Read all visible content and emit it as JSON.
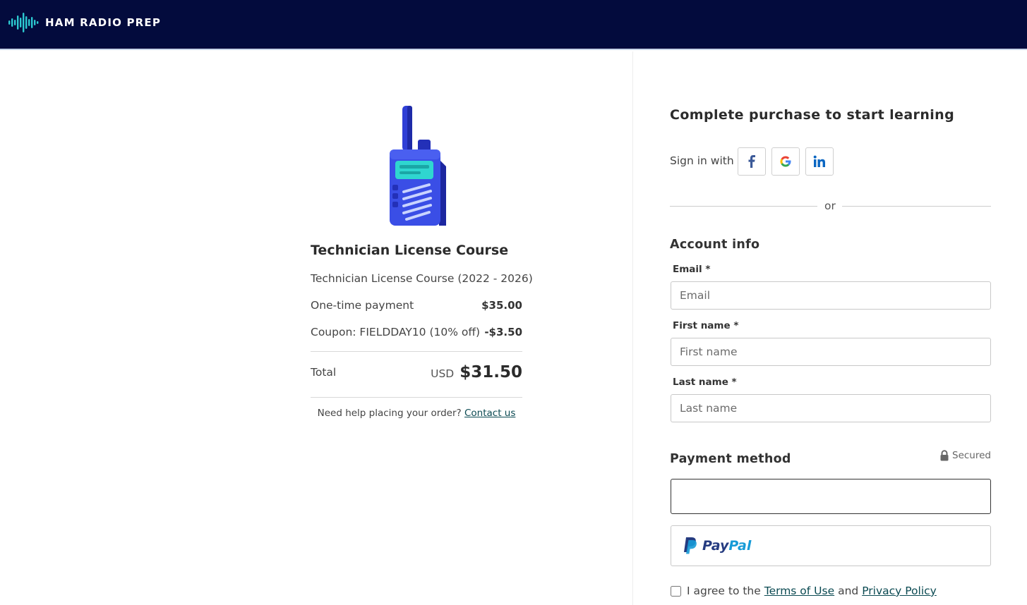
{
  "header": {
    "brand_name": "HAM RADIO PREP"
  },
  "order": {
    "course_title": "Technician License Course",
    "course_subtitle": "Technician License Course (2022 - 2026)",
    "payment_label": "One-time payment",
    "payment_amount": "$35.00",
    "coupon_label": "Coupon: FIELDDAY10 (10% off)",
    "coupon_amount": "-$3.50",
    "total_label": "Total",
    "total_currency": "USD",
    "total_amount": "$31.50",
    "help_text": "Need help placing your order?",
    "help_link": "Contact us"
  },
  "checkout": {
    "title": "Complete purchase to start learning",
    "signin_label": "Sign in with",
    "or_text": "or",
    "account_title": "Account info",
    "email_label": "Email *",
    "email_placeholder": "Email",
    "first_name_label": "First name *",
    "first_name_placeholder": "First name",
    "last_name_label": "Last name *",
    "last_name_placeholder": "Last name",
    "payment_title": "Payment method",
    "secured_text": "Secured",
    "paypal_part1": "Pay",
    "paypal_part2": "Pal",
    "agree_prefix": "I agree to the",
    "terms_link": "Terms of Use",
    "agree_and": "and",
    "privacy_link": "Privacy Policy"
  },
  "icons": {
    "logo": "waveform-icon",
    "social": [
      "facebook-icon",
      "google-icon",
      "linkedin-icon"
    ],
    "secured": "lock-icon",
    "paypal": "paypal-icon"
  },
  "colors": {
    "header_bg": "#030b3d",
    "logo_wave": "#2cc9d1",
    "link": "#0b4a52",
    "facebook": "#3b5998",
    "linkedin": "#0a66c2",
    "paypal_dark": "#253b80",
    "paypal_light": "#179bd7"
  }
}
